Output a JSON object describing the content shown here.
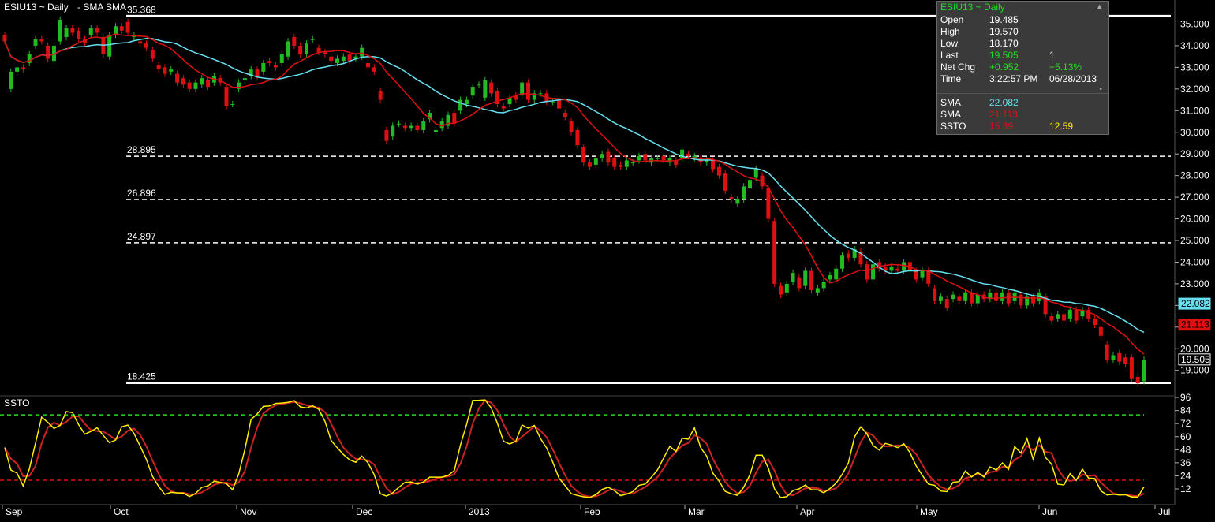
{
  "header": {
    "symbol": "ESIU13 ~ Daily",
    "studies": "-  SMA SMA"
  },
  "info_panel": {
    "title": "ESIU13 ~ Daily",
    "rows": [
      {
        "label": "Open",
        "v1": "19.485",
        "v2": ""
      },
      {
        "label": "High",
        "v1": "19.570",
        "v2": ""
      },
      {
        "label": "Low",
        "v1": "18.170",
        "v2": ""
      },
      {
        "label": "Last",
        "v1": "19.505",
        "v2": "1"
      },
      {
        "label": "Net Chg",
        "v1": "+0.952",
        "v2": "+5.13%"
      },
      {
        "label": "Time",
        "v1": "3:22:57 PM",
        "v2": "06/28/2013"
      }
    ],
    "study_rows": [
      {
        "label": "SMA",
        "v1": "22.082",
        "v2": ""
      },
      {
        "label": "SMA",
        "v1": "21.113",
        "v2": ""
      },
      {
        "label": "SSTO",
        "v1": "15.39",
        "v2": "12.59"
      }
    ],
    "colors": {
      "title": "#22dd22",
      "last": "#22dd22",
      "sma_blue": "#66e0f0",
      "sma_red": "#dd1111",
      "ssto_red": "#dd1111",
      "ssto_yellow": "#ffee00"
    }
  },
  "ssto_label": "SSTO",
  "chart_data": {
    "type": "candlestick",
    "y_axis_ticks": [
      "35.000",
      "34.000",
      "33.000",
      "32.000",
      "31.000",
      "30.000",
      "29.000",
      "28.000",
      "27.000",
      "26.000",
      "25.000",
      "24.000",
      "23.000",
      "22.000",
      "21.000",
      "20.000",
      "19.000"
    ],
    "x_axis_labels": [
      "Sep",
      "Oct",
      "Nov",
      "Dec",
      "2013",
      "Feb",
      "Mar",
      "Apr",
      "May",
      "Jun",
      "Jul"
    ],
    "levels": [
      {
        "value": 35.368,
        "label": "35.368",
        "style": "solid"
      },
      {
        "value": 28.895,
        "label": "28.895",
        "style": "dashed"
      },
      {
        "value": 26.896,
        "label": "26.896",
        "style": "dashed"
      },
      {
        "value": 24.897,
        "label": "24.897",
        "style": "dashed"
      },
      {
        "value": 18.425,
        "label": "18.425",
        "style": "solid"
      }
    ],
    "price_tags": [
      {
        "value": 22.082,
        "label": "22.082",
        "color": "#66e0f0"
      },
      {
        "value": 21.113,
        "label": "21.113",
        "color": "#dd1111"
      },
      {
        "value": 19.505,
        "label": "19.505",
        "color": "#ffffff"
      }
    ],
    "candles": [
      [
        34.5,
        34.2
      ],
      [
        32.0,
        32.8
      ],
      [
        32.8,
        33.0
      ],
      [
        33.0,
        32.9
      ],
      [
        33.2,
        33.6
      ],
      [
        34.0,
        34.3
      ],
      [
        34.3,
        34.2
      ],
      [
        34.0,
        33.4
      ],
      [
        33.3,
        34.0
      ],
      [
        34.2,
        35.2
      ],
      [
        34.4,
        34.8
      ],
      [
        34.8,
        34.6
      ],
      [
        34.7,
        34.3
      ],
      [
        34.3,
        34.1
      ],
      [
        34.5,
        34.8
      ],
      [
        34.8,
        34.6
      ],
      [
        34.4,
        33.6
      ],
      [
        33.5,
        34.5
      ],
      [
        34.5,
        34.9
      ],
      [
        34.9,
        34.7
      ],
      [
        35.1,
        34.6
      ],
      [
        34.4,
        34.5
      ],
      [
        34.2,
        34.1
      ],
      [
        34.1,
        33.9
      ],
      [
        33.8,
        33.4
      ],
      [
        33.1,
        32.9
      ],
      [
        33.0,
        32.7
      ],
      [
        32.8,
        32.9
      ],
      [
        32.7,
        32.3
      ],
      [
        32.5,
        32.2
      ],
      [
        32.3,
        32.0
      ],
      [
        32.0,
        32.3
      ],
      [
        32.2,
        32.5
      ],
      [
        32.4,
        32.1
      ],
      [
        32.3,
        32.6
      ],
      [
        32.5,
        32.3
      ],
      [
        32.1,
        31.2
      ],
      [
        31.3,
        31.3
      ],
      [
        32.0,
        32.3
      ],
      [
        32.4,
        32.5
      ],
      [
        32.6,
        32.9
      ],
      [
        32.9,
        32.6
      ],
      [
        32.8,
        33.2
      ],
      [
        33.3,
        33.2
      ],
      [
        33.1,
        33.0
      ],
      [
        33.2,
        33.6
      ],
      [
        33.5,
        34.2
      ],
      [
        34.4,
        34.0
      ],
      [
        34.0,
        33.6
      ],
      [
        33.6,
        34.1
      ],
      [
        34.3,
        34.3
      ],
      [
        33.9,
        33.7
      ],
      [
        33.7,
        33.6
      ],
      [
        33.5,
        33.3
      ],
      [
        33.2,
        33.4
      ],
      [
        33.3,
        33.5
      ],
      [
        33.6,
        33.3
      ],
      [
        33.4,
        33.5
      ],
      [
        33.5,
        33.9
      ],
      [
        33.2,
        33.0
      ],
      [
        33.0,
        32.8
      ],
      [
        31.9,
        31.5
      ],
      [
        30.1,
        29.6
      ],
      [
        29.8,
        30.3
      ],
      [
        30.4,
        30.4
      ],
      [
        30.3,
        30.2
      ],
      [
        30.2,
        30.3
      ],
      [
        30.3,
        30.1
      ],
      [
        30.1,
        30.5
      ],
      [
        30.6,
        30.9
      ],
      [
        30.0,
        30.1
      ],
      [
        30.2,
        30.5
      ],
      [
        30.3,
        30.8
      ],
      [
        30.9,
        30.4
      ],
      [
        31.0,
        31.5
      ],
      [
        31.3,
        31.5
      ],
      [
        31.7,
        32.1
      ],
      [
        32.2,
        32.2
      ],
      [
        31.6,
        32.4
      ],
      [
        32.3,
        31.8
      ],
      [
        31.9,
        31.3
      ],
      [
        31.2,
        31.1
      ],
      [
        31.3,
        31.6
      ],
      [
        31.7,
        31.5
      ],
      [
        31.7,
        32.3
      ],
      [
        32.3,
        31.5
      ],
      [
        31.5,
        31.8
      ],
      [
        31.8,
        31.8
      ],
      [
        31.8,
        31.4
      ],
      [
        31.4,
        31.4
      ],
      [
        31.5,
        31.1
      ],
      [
        30.9,
        30.7
      ],
      [
        30.5,
        30.0
      ],
      [
        30.1,
        29.4
      ],
      [
        29.3,
        28.6
      ],
      [
        28.6,
        28.4
      ],
      [
        28.5,
        28.8
      ],
      [
        28.8,
        29.0
      ],
      [
        29.1,
        28.6
      ],
      [
        28.8,
        28.4
      ],
      [
        28.5,
        28.4
      ],
      [
        28.4,
        28.7
      ],
      [
        28.6,
        28.6
      ],
      [
        28.7,
        28.9
      ],
      [
        29.0,
        28.7
      ],
      [
        28.6,
        28.8
      ],
      [
        28.8,
        28.8
      ],
      [
        28.9,
        28.7
      ],
      [
        28.6,
        28.8
      ],
      [
        28.7,
        28.5
      ],
      [
        28.8,
        29.2
      ],
      [
        29.0,
        28.9
      ],
      [
        28.8,
        28.9
      ],
      [
        28.8,
        28.6
      ],
      [
        28.6,
        28.7
      ],
      [
        28.7,
        28.3
      ],
      [
        28.4,
        28.0
      ],
      [
        28.1,
        27.3
      ],
      [
        27.0,
        26.9
      ],
      [
        26.7,
        26.9
      ],
      [
        26.9,
        27.5
      ],
      [
        27.4,
        27.8
      ],
      [
        27.9,
        28.3
      ],
      [
        28.0,
        27.5
      ],
      [
        27.4,
        26.0
      ],
      [
        25.9,
        23.0
      ],
      [
        22.9,
        22.5
      ],
      [
        22.6,
        23.0
      ],
      [
        23.1,
        23.5
      ],
      [
        23.3,
        22.8
      ],
      [
        22.9,
        23.6
      ],
      [
        23.6,
        22.7
      ],
      [
        22.6,
        22.8
      ],
      [
        22.8,
        23.1
      ],
      [
        23.2,
        23.4
      ],
      [
        23.2,
        23.7
      ],
      [
        23.7,
        24.3
      ],
      [
        24.4,
        24.2
      ],
      [
        24.2,
        24.6
      ],
      [
        24.5,
        23.9
      ],
      [
        23.9,
        23.2
      ],
      [
        23.2,
        23.9
      ],
      [
        24.0,
        23.7
      ],
      [
        23.8,
        23.6
      ],
      [
        23.6,
        23.8
      ],
      [
        23.7,
        23.6
      ],
      [
        23.6,
        24.0
      ],
      [
        24.0,
        23.6
      ],
      [
        23.6,
        23.2
      ],
      [
        23.3,
        23.6
      ],
      [
        23.6,
        23.0
      ],
      [
        22.8,
        22.2
      ],
      [
        22.2,
        22.4
      ],
      [
        22.3,
        21.9
      ],
      [
        22.3,
        22.5
      ],
      [
        22.4,
        22.2
      ],
      [
        22.2,
        22.6
      ],
      [
        22.6,
        22.1
      ],
      [
        22.1,
        22.5
      ],
      [
        22.5,
        22.3
      ],
      [
        22.3,
        22.6
      ],
      [
        22.6,
        22.2
      ],
      [
        22.2,
        22.6
      ],
      [
        22.6,
        22.1
      ],
      [
        22.2,
        22.6
      ],
      [
        22.5,
        22.0
      ],
      [
        22.0,
        22.4
      ],
      [
        22.4,
        22.1
      ],
      [
        22.2,
        22.6
      ],
      [
        22.4,
        21.6
      ],
      [
        21.5,
        21.3
      ],
      [
        21.4,
        21.6
      ],
      [
        21.6,
        21.3
      ],
      [
        21.4,
        21.8
      ],
      [
        21.8,
        21.3
      ],
      [
        21.5,
        21.8
      ],
      [
        21.8,
        21.4
      ],
      [
        21.4,
        21.1
      ],
      [
        21.0,
        20.6
      ],
      [
        20.2,
        19.5
      ],
      [
        19.5,
        19.7
      ],
      [
        19.8,
        19.4
      ],
      [
        19.6,
        19.3
      ],
      [
        19.6,
        18.6
      ],
      [
        18.7,
        18.4
      ],
      [
        18.5,
        19.5
      ]
    ],
    "sma_slow": [],
    "sma_fast": [],
    "ssto_axis_ticks": [
      "96",
      "84",
      "72",
      "60",
      "48",
      "36",
      "24",
      "12"
    ],
    "ssto_levels": [
      {
        "value": 80,
        "color": "#22dd22"
      },
      {
        "value": 20,
        "color": "#dd1111"
      }
    ],
    "ylim": [
      18.0,
      36.0
    ]
  }
}
